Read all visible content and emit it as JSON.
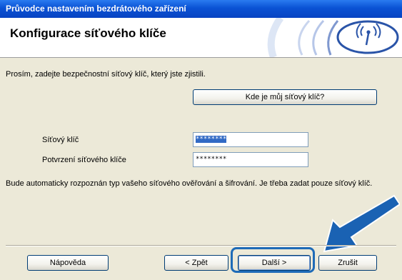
{
  "window": {
    "title": "Průvodce nastavením bezdrátového zařízení"
  },
  "header": {
    "title": "Konfigurace síťového klíče"
  },
  "prompt": "Prosím, zadejte bezpečnostní síťový klíč, který jste zjistili.",
  "help_key_button": "Kde je můj síťový klíč?",
  "fields": {
    "network_key": {
      "label": "Síťový klíč",
      "value": "********"
    },
    "confirm_key": {
      "label": "Potvrzení síťového klíče",
      "value": "********"
    }
  },
  "note": "Bude automaticky rozpoznán typ vašeho síťového ověřování a šifrování. Je třeba zadat pouze síťový klíč.",
  "buttons": {
    "help": "Nápověda",
    "back": "< Zpět",
    "next": "Další >",
    "cancel": "Zrušit"
  },
  "colors": {
    "titlebar": "#0a52d4",
    "accent_arrow": "#1a62b3",
    "wifi_icon": "#2a54a8"
  },
  "icons": {
    "header": "wireless-signal-icon",
    "annotation": "pointer-arrow-icon"
  }
}
